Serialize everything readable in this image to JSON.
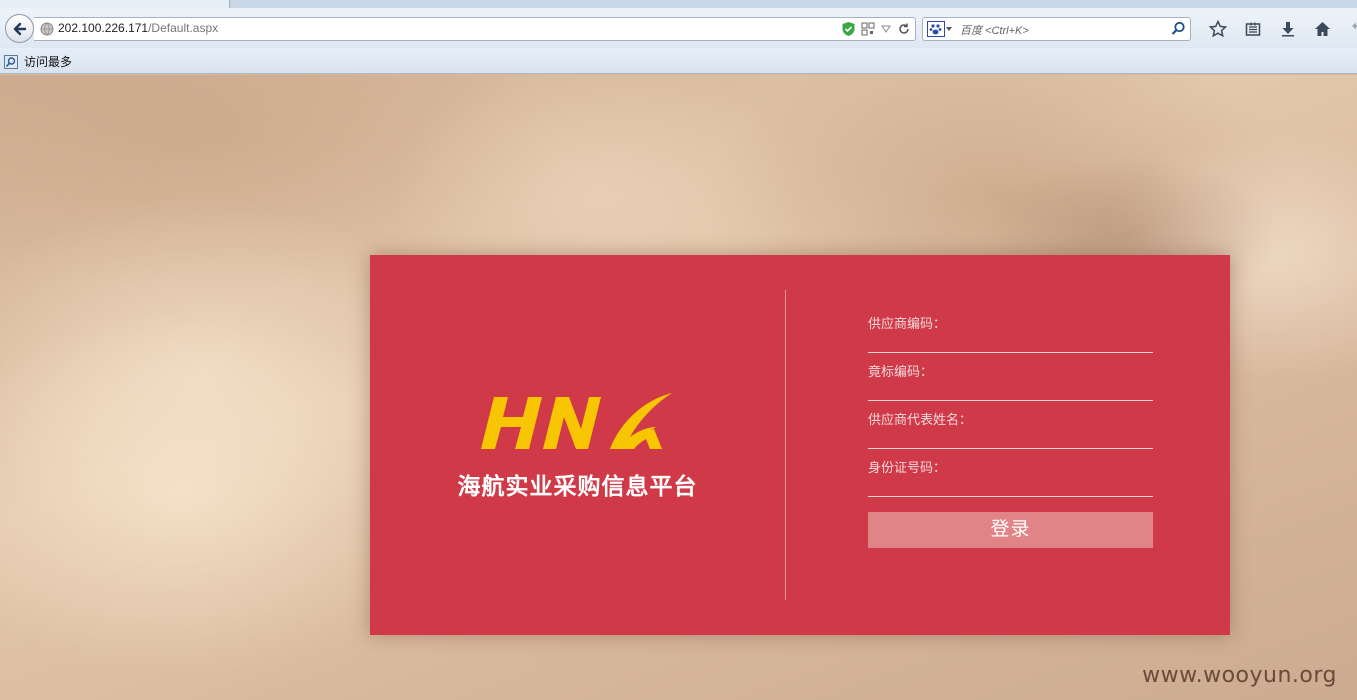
{
  "browser": {
    "url_host": "202.100.226.171",
    "url_path": "/Default.aspx",
    "search_placeholder": "百度 <Ctrl+K>",
    "bookmarks": [
      {
        "label": "访问最多",
        "icon": "bookmark-search-icon"
      }
    ],
    "toolbar_icons": [
      "star-icon",
      "reading-list-icon",
      "download-icon",
      "home-icon",
      "undo-icon"
    ]
  },
  "login": {
    "logo_text": "HNA",
    "platform_name": "海航实业采购信息平台",
    "fields": [
      {
        "label": "供应商编码：",
        "value": ""
      },
      {
        "label": "竟标编码：",
        "value": ""
      },
      {
        "label": "供应商代表姓名：",
        "value": ""
      },
      {
        "label": "身份证号码：",
        "value": ""
      }
    ],
    "submit_label": "登录"
  },
  "watermark": "www.wooyun.org",
  "colors": {
    "card": "#d03a48",
    "button": "#e08487",
    "logo_yellow": "#f7c600"
  }
}
